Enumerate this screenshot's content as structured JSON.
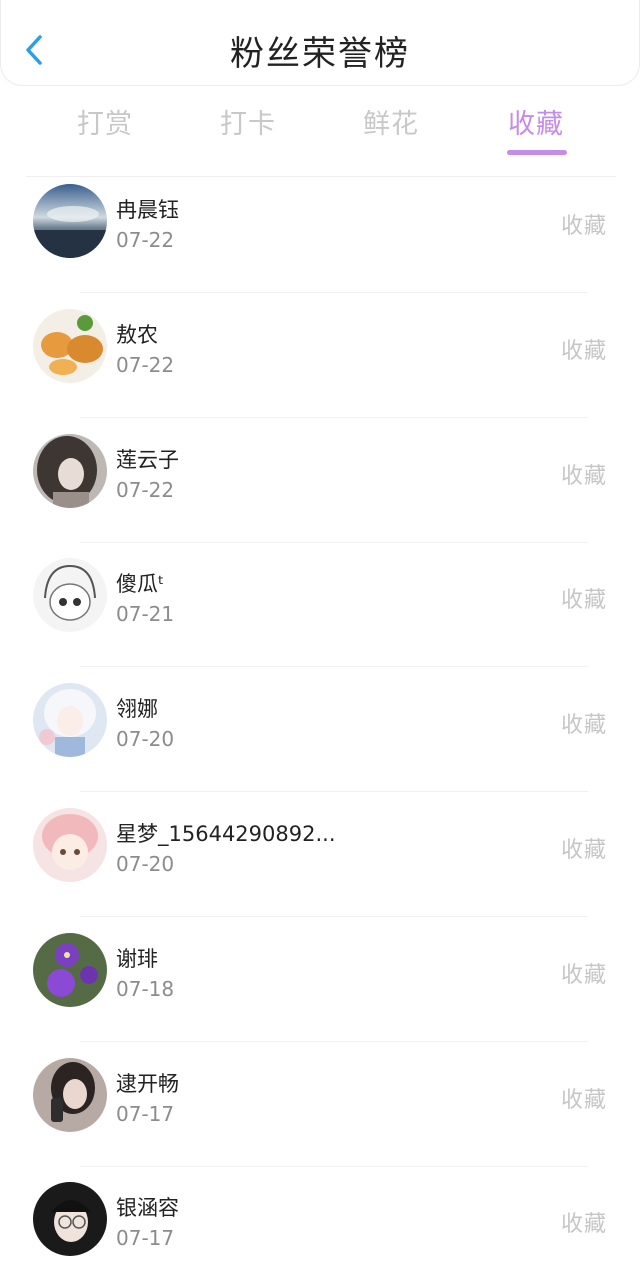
{
  "header": {
    "title": "粉丝荣誉榜",
    "back_icon": "chevron-left-icon"
  },
  "colors": {
    "accent": "#c58de8",
    "back": "#2a9ee8",
    "muted": "#c6c6c6"
  },
  "tabs": [
    {
      "label": "打赏",
      "active": false
    },
    {
      "label": "打卡",
      "active": false
    },
    {
      "label": "鲜花",
      "active": false
    },
    {
      "label": "收藏",
      "active": true
    }
  ],
  "fans": [
    {
      "name": "冉晨钰",
      "date": "07-22",
      "action": "收藏"
    },
    {
      "name": "敖农",
      "date": "07-22",
      "action": "收藏"
    },
    {
      "name": "莲云子",
      "date": "07-22",
      "action": "收藏"
    },
    {
      "name": "傻瓜ᵗ",
      "date": "07-21",
      "action": "收藏"
    },
    {
      "name": "翎娜",
      "date": "07-20",
      "action": "收藏"
    },
    {
      "name": "星梦_15644290892...",
      "date": "07-20",
      "action": "收藏"
    },
    {
      "name": "谢琲",
      "date": "07-18",
      "action": "收藏"
    },
    {
      "name": "逮开畅",
      "date": "07-17",
      "action": "收藏"
    },
    {
      "name": "银涵容",
      "date": "07-17",
      "action": "收藏"
    }
  ]
}
